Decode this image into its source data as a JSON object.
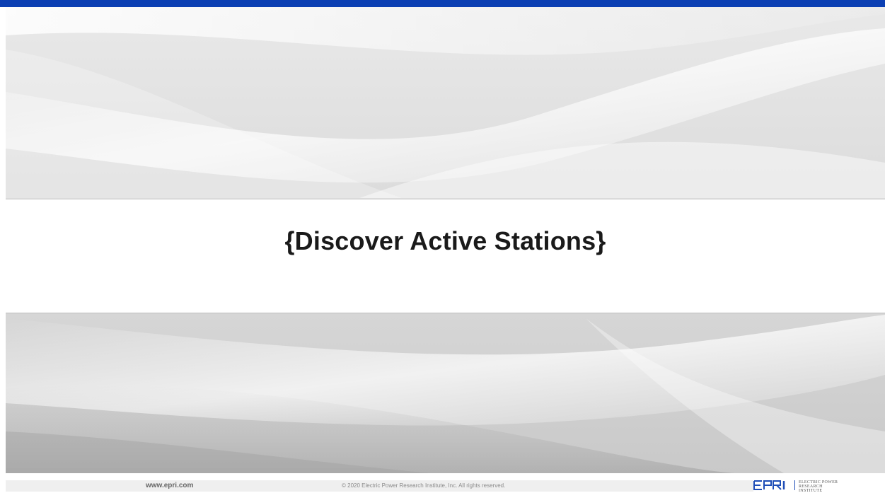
{
  "slide": {
    "title": "{Discover Active Stations}"
  },
  "footer": {
    "url": "www.epri.com",
    "copyright": "© 2020 Electric Power Research Institute, Inc. All rights reserved."
  },
  "logo": {
    "wordmark": "EPRI",
    "tagline_line1": "ELECTRIC POWER",
    "tagline_line2": "RESEARCH INSTITUTE"
  },
  "colors": {
    "accent": "#0b3fb3",
    "title_text": "#1a1a1a",
    "background": "#dcdcdc"
  }
}
